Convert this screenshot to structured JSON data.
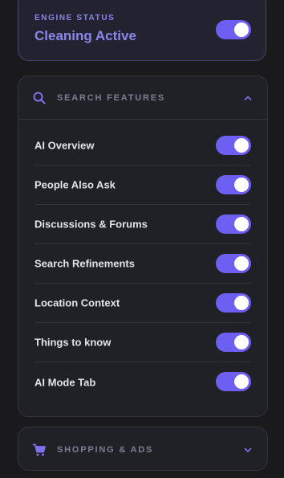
{
  "engine_status": {
    "kicker": "ENGINE STATUS",
    "title": "Cleaning Active",
    "enabled": true
  },
  "search_features": {
    "icon": "search-icon",
    "title": "SEARCH FEATURES",
    "expanded": true,
    "items": [
      {
        "label": "AI Overview",
        "enabled": true
      },
      {
        "label": "People Also Ask",
        "enabled": true
      },
      {
        "label": "Discussions & Forums",
        "enabled": true
      },
      {
        "label": "Search Refinements",
        "enabled": true
      },
      {
        "label": "Location Context",
        "enabled": true
      },
      {
        "label": "Things to know",
        "enabled": true
      },
      {
        "label": "AI Mode Tab",
        "enabled": true
      }
    ]
  },
  "shopping_ads": {
    "icon": "shopping-cart-icon",
    "title": "SHOPPING & ADS",
    "expanded": false
  },
  "colors": {
    "accent": "#6c5ff1",
    "accent_text": "#8b86ea",
    "background": "#1a1a1d",
    "panel": "#202027"
  }
}
